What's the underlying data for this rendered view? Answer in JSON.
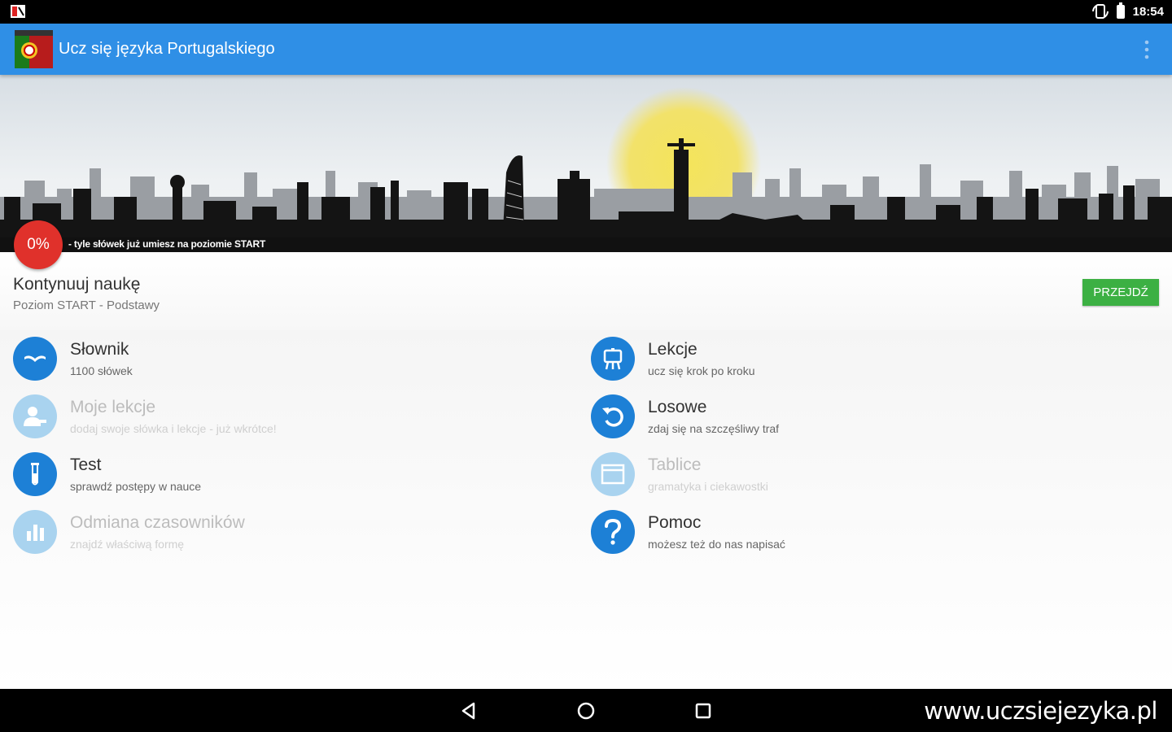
{
  "status_bar": {
    "time": "18:54"
  },
  "app_bar": {
    "title": "Ucz się języka Portugalskiego"
  },
  "banner": {
    "progress_percent": "0%",
    "progress_text": "- tyle słówek już umiesz na poziomie START"
  },
  "continue": {
    "title": "Kontynuuj naukę",
    "subtitle": "Poziom START - Podstawy",
    "button_label": "PRZEJDŹ"
  },
  "menu": {
    "items": [
      {
        "label": "Słownik",
        "sub": "1100 słówek",
        "icon": "book-icon",
        "enabled": true
      },
      {
        "label": "Lekcje",
        "sub": "ucz się krok po kroku",
        "icon": "easel-icon",
        "enabled": true
      },
      {
        "label": "Moje lekcje",
        "sub": "dodaj swoje słówka i lekcje - już wkrótce!",
        "icon": "user-edit-icon",
        "enabled": false
      },
      {
        "label": "Losowe",
        "sub": "zdaj się na szczęśliwy traf",
        "icon": "undo-icon",
        "enabled": true
      },
      {
        "label": "Test",
        "sub": "sprawdź postępy w nauce",
        "icon": "test-tube-icon",
        "enabled": true
      },
      {
        "label": "Tablice",
        "sub": "gramatyka i ciekawostki",
        "icon": "table-icon",
        "enabled": false
      },
      {
        "label": "Odmiana czasowników",
        "sub": "znajdź właściwą formę",
        "icon": "bar-chart-icon",
        "enabled": false
      },
      {
        "label": "Pomoc",
        "sub": "możesz też do nas napisać",
        "icon": "question-icon",
        "enabled": true
      }
    ]
  },
  "footer": {
    "url": "www.uczsiejezyka.pl"
  },
  "colors": {
    "app_bar": "#2f8fe6",
    "icon_enabled": "#1d80d6",
    "icon_disabled": "#a9d3ef",
    "badge": "#e0312b",
    "go_button": "#3cb043"
  }
}
